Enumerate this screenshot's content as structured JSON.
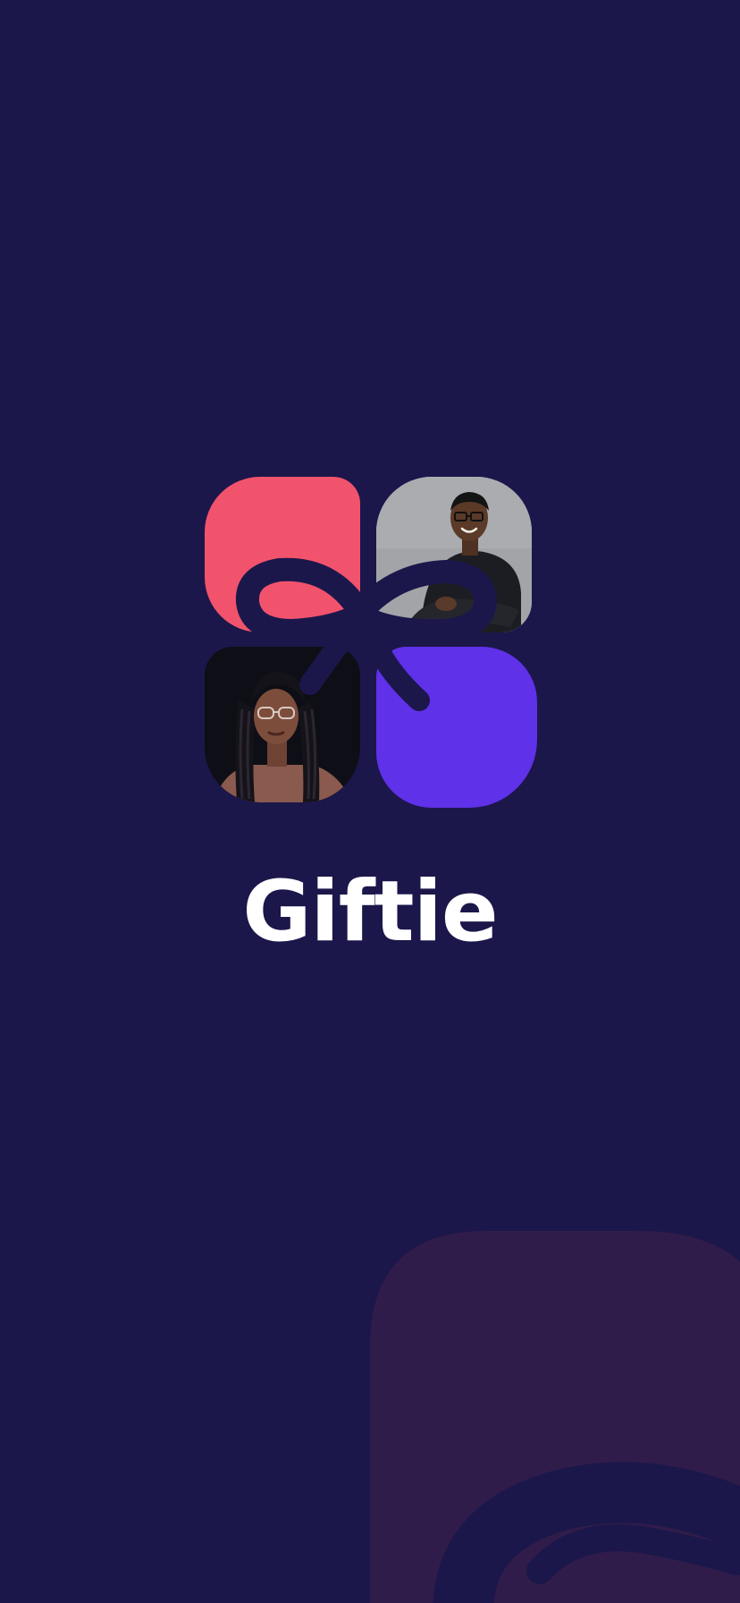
{
  "app": {
    "name": "Giftie"
  },
  "logo": {
    "icon": "gift-bow-logo-icon",
    "tiles": {
      "top_left": {
        "kind": "color",
        "color": "#f2536c"
      },
      "top_right": {
        "kind": "photo",
        "icon": "person-photo-icon"
      },
      "bottom_left": {
        "kind": "photo",
        "icon": "person-photo-icon"
      },
      "bottom_right": {
        "kind": "color",
        "color": "#5f31e8"
      }
    }
  },
  "theme": {
    "background": "#1b174b",
    "decor_tile": "#301c4a",
    "ribbon": "#1b174b",
    "text": "#ffffff"
  }
}
